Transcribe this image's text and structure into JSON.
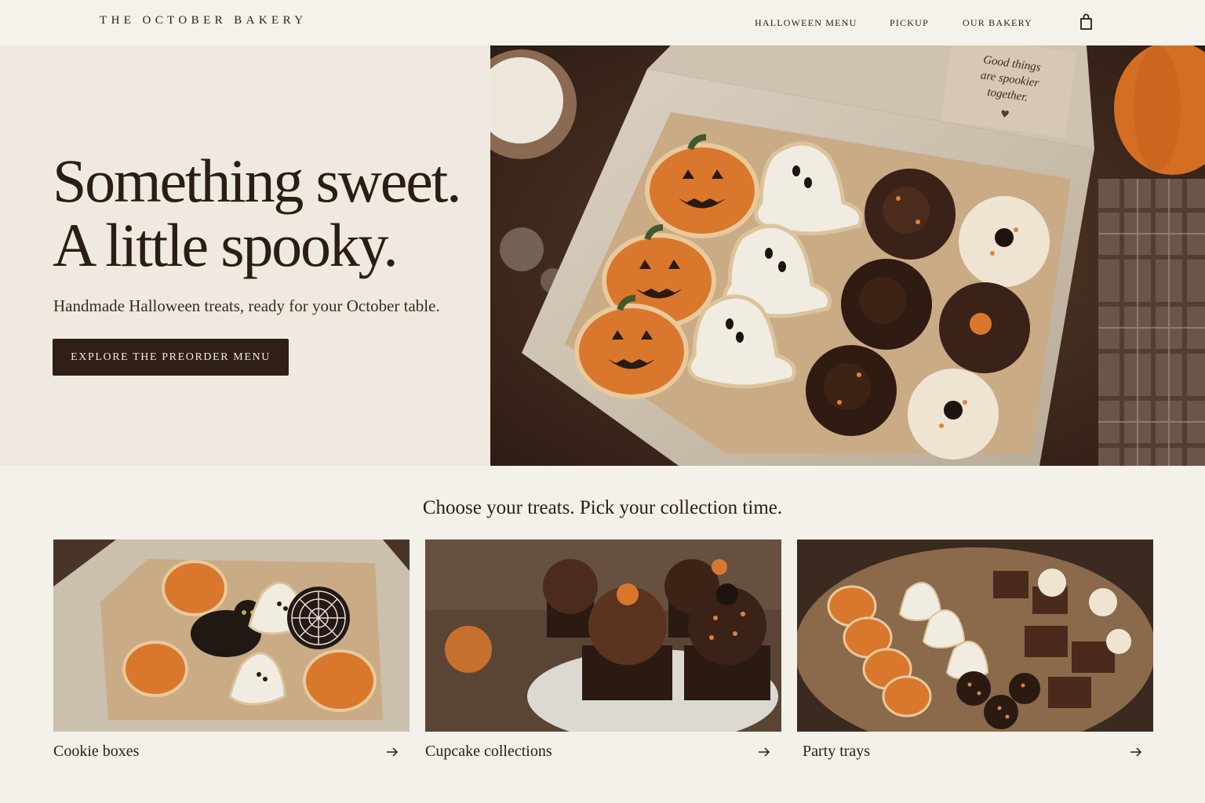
{
  "header": {
    "brand": "THE OCTOBER BAKERY",
    "nav": [
      "HALLOWEEN MENU",
      "PICKUP",
      "OUR BAKERY"
    ],
    "cart_icon": "shopping-bag-icon"
  },
  "hero": {
    "title_line1": "Something sweet.",
    "title_line2": "A little spooky.",
    "subtitle": "Handmade Halloween treats, ready for your October table.",
    "cta_label": "EXPLORE THE PREORDER MENU",
    "image_note": "Good things are spookier together.",
    "note_line1": "Good things",
    "note_line2": "are spookier",
    "note_line3": "together."
  },
  "section": {
    "title": "Choose your treats. Pick your collection time."
  },
  "collections": [
    {
      "label": "Cookie boxes",
      "icon": "arrow-right-icon"
    },
    {
      "label": "Cupcake collections",
      "icon": "arrow-right-icon"
    },
    {
      "label": "Party trays",
      "icon": "arrow-right-icon"
    }
  ],
  "colors": {
    "background": "#f4f0ea",
    "hero_panel": "#efe9e1",
    "text": "#2c1d14",
    "button": "#2f1f16",
    "pumpkin": "#d9782d",
    "chocolate": "#3a2218"
  }
}
